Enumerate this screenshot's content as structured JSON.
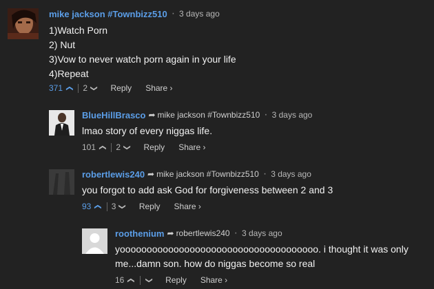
{
  "comments": [
    {
      "author": "mike jackson #Townbizz510",
      "time": "3 days ago",
      "reply_to": "",
      "text": "1)Watch Porn\n2) Nut\n3)Vow to never watch porn again in your life\n4)Repeat",
      "likes": "371",
      "dislikes": "2",
      "reply_label": "Reply",
      "share_label": "Share ›"
    },
    {
      "author": "BlueHillBrasco",
      "time": "3 days ago",
      "reply_to": "mike jackson #Townbizz510",
      "text": "lmao story of every niggas life.",
      "likes": "101",
      "dislikes": "2",
      "reply_label": "Reply",
      "share_label": "Share ›"
    },
    {
      "author": "robertlewis240",
      "time": "3 days ago",
      "reply_to": "mike jackson #Townbizz510",
      "text": "you forgot to add ask God for forgiveness between 2 and 3",
      "likes": "93",
      "dislikes": "3",
      "reply_label": "Reply",
      "share_label": "Share ›"
    },
    {
      "author": "roothenium",
      "time": "3 days ago",
      "reply_to": "robertlewis240",
      "text": "yooooooooooooooooooooooooooooooooooooo. i thought it was only me...damn son. how do niggas become so real",
      "likes": "16",
      "dislikes": "",
      "reply_label": "Reply",
      "share_label": "Share ›"
    }
  ]
}
